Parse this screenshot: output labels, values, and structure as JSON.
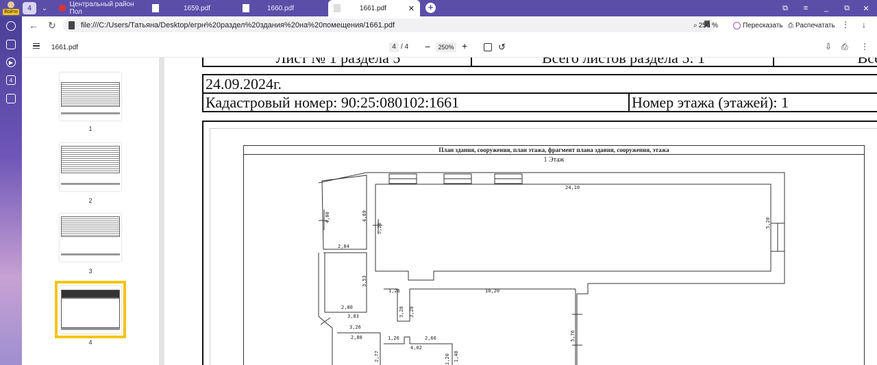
{
  "browser": {
    "login_label": "Войти",
    "workspace_number": "4",
    "tabs": [
      {
        "label": "Центральный район Пол",
        "active": false
      },
      {
        "label": "1659.pdf",
        "active": false
      },
      {
        "label": "1660.pdf",
        "active": false
      },
      {
        "label": "1661.pdf",
        "active": true
      }
    ],
    "url": "file:///C:/Users/Татьяна/Desktop/егрн%20раздел%20здания%20на%20помещения/1661.pdf",
    "zoom": "250 %",
    "retell_label": "Пересказать",
    "print_label": "Распечатать",
    "sidebar_badge": "4"
  },
  "pdf": {
    "filename": "1661.pdf",
    "current_page": "4",
    "total_pages": "/ 4",
    "zoom": "250%",
    "thumbnails": [
      {
        "num": "1",
        "selected": false
      },
      {
        "num": "2",
        "selected": false
      },
      {
        "num": "3",
        "selected": false
      },
      {
        "num": "4",
        "selected": true
      }
    ]
  },
  "document": {
    "top_left_partial": "Лист № 1 раздела 5",
    "top_mid_partial": "Всего листов раздела 5: 1",
    "top_right_partial": "Все",
    "date": "24.09.2024г.",
    "cadastral": "Кадастровый номер: 90:25:080102:1661",
    "floor": "Номер этажа (этажей): 1",
    "plan_title": "План здания, сооружения, план этажа, фрагмент плана здания, сооружения, этажа",
    "floor_label": "1 Этаж",
    "dims": {
      "d1": "24,10",
      "d2": "5,20",
      "d3": "5,20",
      "d4": "4,00",
      "d5": "4,69",
      "d6": "2,84",
      "d7": "3,53",
      "d8": "2,80",
      "d9": "1,26",
      "d10": "10,20",
      "d11": "3,28",
      "d12": "3,28",
      "d13": "3,83",
      "d14": "3,26",
      "d15": "2,88",
      "d16": "1,26",
      "d17": "2,66",
      "d18": "4,02",
      "d19": "5,76",
      "d20": "2,77",
      "d21": "1,20",
      "d22": "1,48"
    }
  }
}
